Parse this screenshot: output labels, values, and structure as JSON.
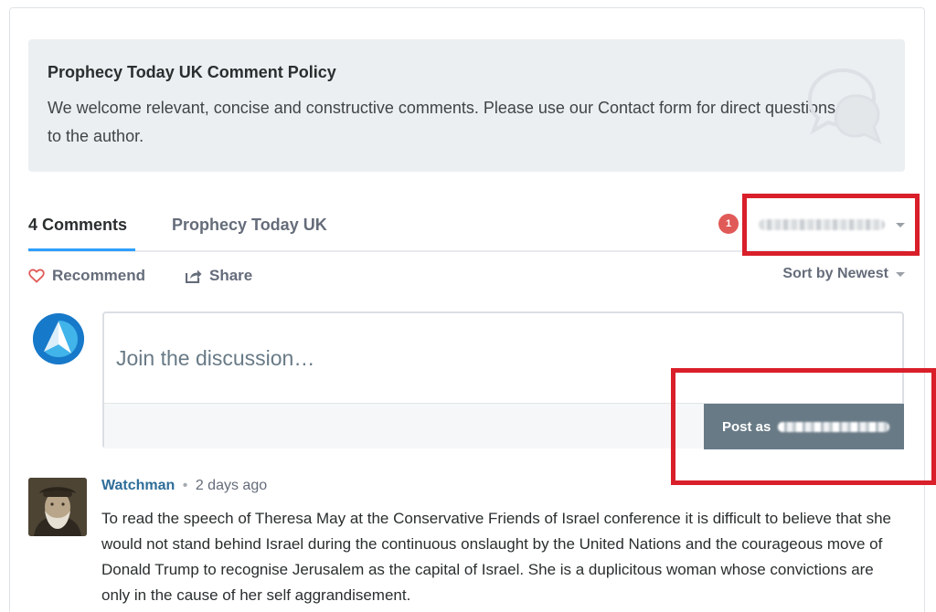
{
  "policy": {
    "title": "Prophecy Today UK Comment Policy",
    "text": "We welcome relevant, concise and constructive comments. Please use our Contact form for direct questions to the author."
  },
  "tabs": {
    "comments_label": "4 Comments",
    "site_label": "Prophecy Today UK"
  },
  "notifications": {
    "count": "1"
  },
  "actions": {
    "recommend_label": "Recommend",
    "share_label": "Share",
    "sort_label": "Sort by Newest"
  },
  "composer": {
    "placeholder": "Join the discussion…",
    "post_label": "Post as"
  },
  "comment": {
    "author": "Watchman",
    "separator": "•",
    "time": "2 days ago",
    "body": "To read the speech of Theresa May at the Conservative Friends of Israel conference it is difficult to believe that she would not stand behind Israel during the continuous onslaught by the United Nations and the courageous move of Donald Trump to recognise Jerusalem as the capital of Israel. She is a duplicitous woman whose convictions are only in the cause of her self aggrandisement."
  },
  "colors": {
    "accent": "#2e9fff",
    "annotation_red": "#d81f2a",
    "post_button": "#687a86",
    "author_link": "#2e6d99",
    "notification": "#e05a57"
  },
  "icons": [
    "speech-bubbles-icon",
    "heart-icon",
    "share-icon",
    "chevron-down-icon",
    "site-logo-avatar",
    "user-avatar"
  ]
}
